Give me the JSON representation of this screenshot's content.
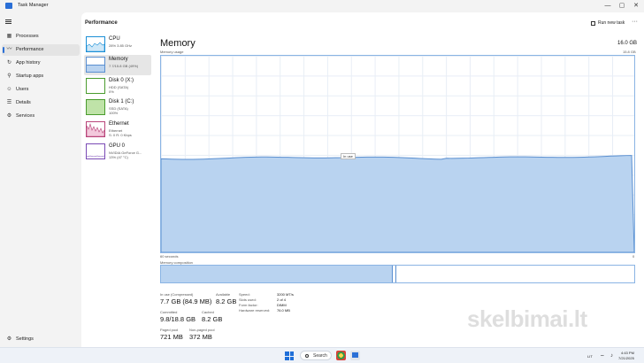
{
  "window": {
    "title": "Task Manager",
    "minimize": "—",
    "maximize": "▢",
    "close": "✕"
  },
  "nav": {
    "items": [
      {
        "label": "Processes",
        "icon": "processes-icon",
        "glyph": "▦"
      },
      {
        "label": "Performance",
        "icon": "performance-icon",
        "glyph": "〰",
        "active": true
      },
      {
        "label": "App history",
        "icon": "app-history-icon",
        "glyph": "↻"
      },
      {
        "label": "Startup apps",
        "icon": "startup-icon",
        "glyph": "⚲"
      },
      {
        "label": "Users",
        "icon": "users-icon",
        "glyph": "☺"
      },
      {
        "label": "Details",
        "icon": "details-icon",
        "glyph": "☰"
      },
      {
        "label": "Services",
        "icon": "services-icon",
        "glyph": "⚙"
      }
    ],
    "settings": "Settings",
    "settings_glyph": "⚙"
  },
  "header": {
    "title": "Performance",
    "run_new_task": "Run new task",
    "more": "···"
  },
  "devices": [
    {
      "name": "CPU",
      "sub1": "28%  3.85 GHz",
      "sub2": "",
      "color": "#1c8fd6",
      "fill": "#cfe8f8"
    },
    {
      "name": "Memory",
      "sub1": "7.7/15.8 GB (49%)",
      "sub2": "",
      "color": "#5a8fd0",
      "fill": "#b9d3f0"
    },
    {
      "name": "Disk 0 (X:)",
      "sub1": "HDD (SATA)",
      "sub2": "0%",
      "color": "#4a9c2e",
      "fill": "#ffffff"
    },
    {
      "name": "Disk 1 (C:)",
      "sub1": "SSD (SATA)",
      "sub2": "100%",
      "color": "#4a9c2e",
      "fill": "#bfe3a8"
    },
    {
      "name": "Ethernet",
      "sub1": "Ethernet",
      "sub2": "S: 0 R: 0 Kbps",
      "color": "#b8457a",
      "fill": "#f3c9dc"
    },
    {
      "name": "GPU 0",
      "sub1": "NVIDIA GeForce G...",
      "sub2": "13% (47 °C)",
      "color": "#7a4ab5",
      "fill": "#e6dcf3"
    }
  ],
  "memory": {
    "title": "Memory",
    "total": "16.0 GB",
    "usage_label": "Memory usage",
    "usage_max": "15.8 GB",
    "usage_fraction": 0.48,
    "tooltip": "In use",
    "time_left": "60 seconds",
    "time_right": "0",
    "composition_label": "Memory composition",
    "in_use_fraction": 0.49,
    "modified_fraction": 0.005
  },
  "stats": {
    "in_use_label": "In use (Compressed)",
    "in_use_value": "7.7 GB (84.9 MB)",
    "available_label": "Available",
    "available_value": "8.2 GB",
    "committed_label": "Committed",
    "committed_value": "9.8/18.8 GB",
    "cached_label": "Cached",
    "cached_value": "8.2 GB",
    "paged_label": "Paged pool",
    "paged_value": "721 MB",
    "nonpaged_label": "Non-paged pool",
    "nonpaged_value": "372 MB"
  },
  "specs": [
    {
      "label": "Speed:",
      "value": "3200 MT/s"
    },
    {
      "label": "Slots used:",
      "value": "2 of 4"
    },
    {
      "label": "Form factor:",
      "value": "DIMM"
    },
    {
      "label": "Hardware reserved:",
      "value": "76.0 MB"
    }
  ],
  "taskbar": {
    "search": "Search",
    "lang": "LIT",
    "time": "4:43 PM",
    "date": "7/21/2025"
  },
  "watermark": "skelbimai.lt"
}
